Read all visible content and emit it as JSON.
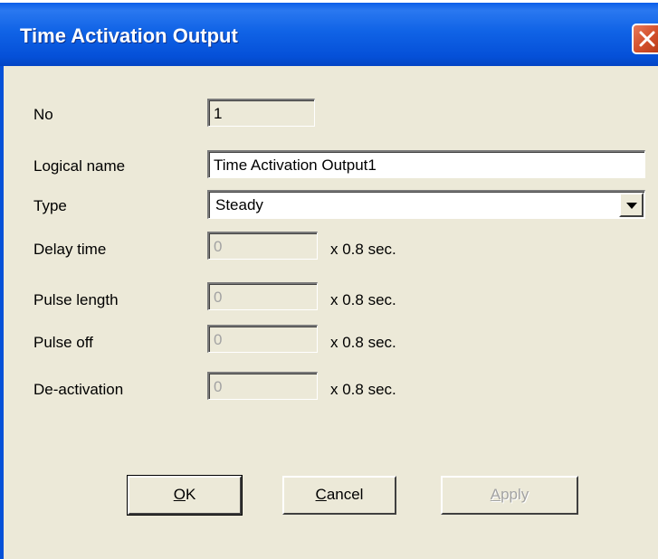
{
  "window": {
    "title": "Time Activation Output"
  },
  "form": {
    "no": {
      "label": "No",
      "value": "1"
    },
    "logical_name": {
      "label": "Logical name",
      "value": "Time Activation Output1"
    },
    "type": {
      "label": "Type",
      "value": "Steady"
    },
    "delay_time": {
      "label": "Delay time",
      "value": "0",
      "unit": "x 0.8 sec."
    },
    "pulse_length": {
      "label": "Pulse length",
      "value": "0",
      "unit": "x 0.8 sec."
    },
    "pulse_off": {
      "label": "Pulse off",
      "value": "0",
      "unit": "x 0.8 sec."
    },
    "deactivation": {
      "label": "De-activation",
      "value": "0",
      "unit": "x 0.8 sec."
    }
  },
  "buttons": {
    "ok": {
      "mnemonic": "O",
      "rest": "K"
    },
    "cancel": {
      "mnemonic": "C",
      "rest": "ancel"
    },
    "apply": {
      "mnemonic": "A",
      "rest": "pply"
    }
  },
  "colors": {
    "titlebar": "#0550d8",
    "dialog_bg": "#ece9d8",
    "close_button": "#d4512c",
    "disabled_text": "#a3a3a3"
  },
  "icons": {
    "close": "close-x-icon",
    "dropdown": "chevron-down-icon"
  }
}
